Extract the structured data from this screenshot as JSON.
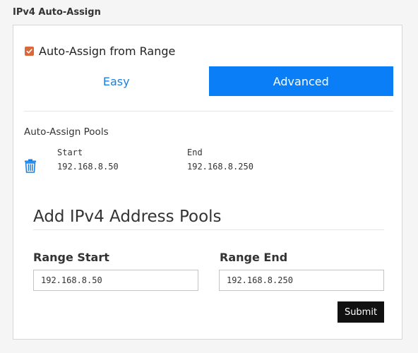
{
  "section": {
    "title": "IPv4 Auto-Assign"
  },
  "auto_assign": {
    "label": "Auto-Assign from Range",
    "checked": true
  },
  "tabs": [
    {
      "label": "Easy",
      "active": false
    },
    {
      "label": "Advanced",
      "active": true
    }
  ],
  "pools": {
    "title": "Auto-Assign Pools",
    "start_label": "Start",
    "end_label": "End",
    "items": [
      {
        "start": "192.168.8.50",
        "end": "192.168.8.250",
        "icon": "trash-icon"
      }
    ]
  },
  "add_pools": {
    "heading": "Add IPv4 Address Pools",
    "range_start_label": "Range Start",
    "range_start_value": "192.168.8.50",
    "range_end_label": "Range End",
    "range_end_value": "192.168.8.250",
    "submit_label": "Submit"
  },
  "colors": {
    "accent": "#0a7ef6",
    "checkbox": "#d9693a",
    "submit": "#111111"
  }
}
